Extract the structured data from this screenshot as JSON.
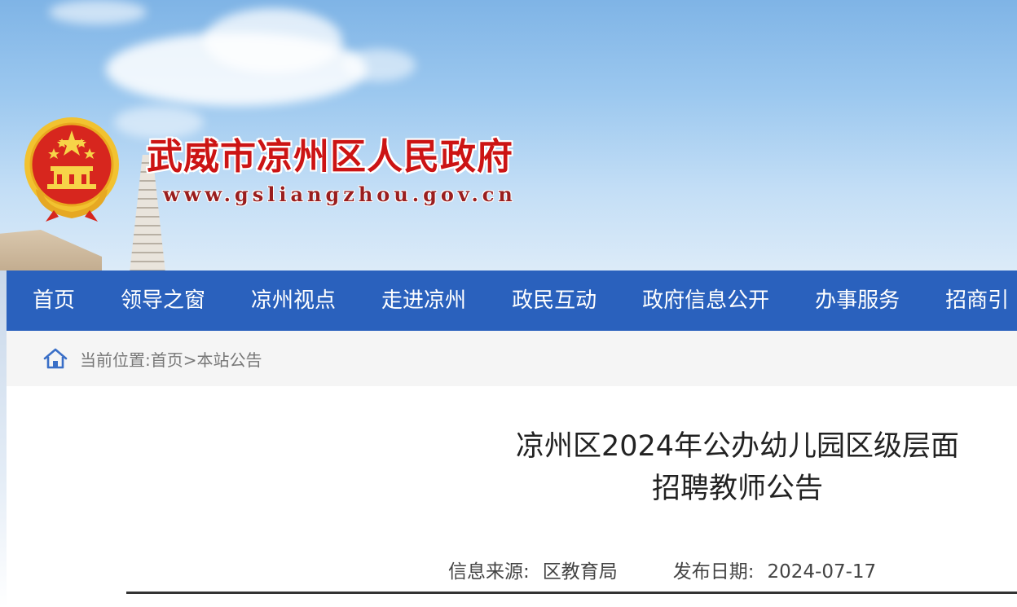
{
  "header": {
    "site_title": "武威市凉州区人民政府",
    "site_url": "www.gsliangzhou.gov.cn"
  },
  "nav": {
    "items": [
      {
        "label": "首页"
      },
      {
        "label": "领导之窗"
      },
      {
        "label": "凉州视点"
      },
      {
        "label": "走进凉州"
      },
      {
        "label": "政民互动"
      },
      {
        "label": "政府信息公开"
      },
      {
        "label": "办事服务"
      },
      {
        "label": "招商引"
      }
    ]
  },
  "breadcrumb": {
    "prefix": "当前位置:",
    "home": "首页",
    "separator": ">",
    "current": "本站公告"
  },
  "article": {
    "title_line1": "凉州区2024年公办幼儿园区级层面",
    "title_line2": "招聘教师公告",
    "source_label": "信息来源:",
    "source_value": "区教育局",
    "date_label": "发布日期:",
    "date_value": "2024-07-17"
  },
  "colors": {
    "nav_bg": "#2a61bd",
    "title_red": "#cc1414",
    "emblem_gold": "#f2c230"
  },
  "icons": {
    "home": "home-icon",
    "emblem": "national-emblem-icon"
  }
}
